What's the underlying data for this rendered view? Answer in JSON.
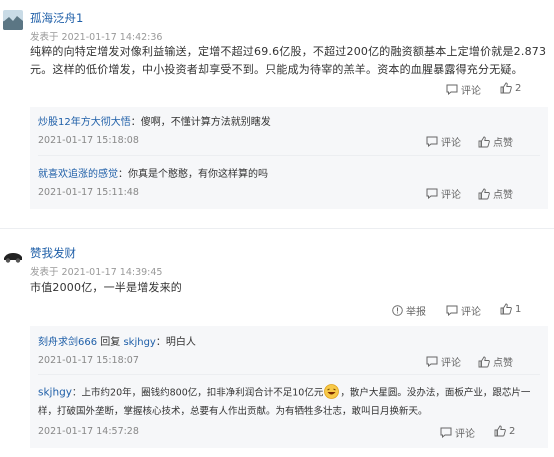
{
  "comments": [
    {
      "username": "孤海泛舟1",
      "time_prefix": "发表于",
      "time": "2021-01-17 14:42:36",
      "text_line1": "纯粹的向特定增发对像利益输送，定增不超过69.6亿股，不超过200亿的融资额基本上定增价就是2.873",
      "text_line2": "元。这样的低价增发，中小投资者却享受不到。只能成为待宰的羔羊。资本的血腥暴露得充分无疑。",
      "comment_label": "评论",
      "like_count": "2",
      "replies": [
        {
          "username": "炒股12年方大彻大悟",
          "sep": "：",
          "text": "傻啊，不懂计算方法就别瞎发",
          "time": "2021-01-17 15:18:08",
          "comment_label": "评论",
          "like_label": "点赞"
        },
        {
          "username": "就喜欢追涨的感觉",
          "sep": "：",
          "text": "你真是个憨憨，有你这样算的吗",
          "time": "2021-01-17 15:11:48",
          "comment_label": "评论",
          "like_label": "点赞"
        }
      ]
    },
    {
      "username": "赞我发财",
      "time_prefix": "发表于",
      "time": "2021-01-17 14:39:45",
      "text_line1": "市值2000亿，一半是增发来的",
      "report_label": "举报",
      "comment_label": "评论",
      "like_count": "1",
      "replies": [
        {
          "username": "刻舟求剑666",
          "reply_word": "回复",
          "reply_to": "skjhgy",
          "sep": "：",
          "text": "明白人",
          "time": "2021-01-17 15:18:07",
          "comment_label": "评论",
          "like_label": "点赞"
        },
        {
          "username": "skjhgy",
          "sep": "：",
          "text_line1_a": "上市约20年，圈钱约800亿，扣非净利润合计不足10亿元",
          "text_line1_b": "，散户大星圆。没办法，面板产业，跟芯片一",
          "text_line2": "样，打破国外垄断，掌握核心技术，总要有人作出贡献。为有牺牲多壮志，敢叫日月换新天。",
          "time": "2021-01-17 14:57:28",
          "comment_label": "评论",
          "like_count": "2"
        }
      ]
    }
  ],
  "colors": {
    "username": "#1f5fa8",
    "meta": "#999999",
    "reply_bg": "#f6f7f9"
  }
}
